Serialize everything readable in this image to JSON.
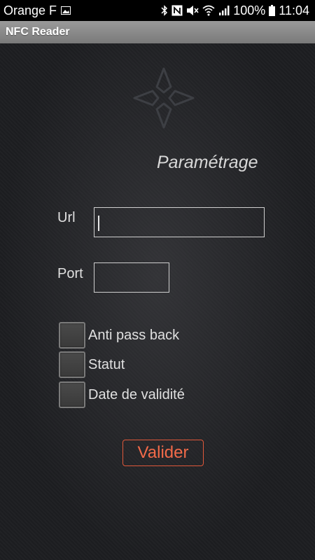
{
  "status_bar": {
    "carrier": "Orange F",
    "battery": "100%",
    "time": "11:04",
    "icons": [
      "image-icon",
      "bluetooth-icon",
      "nfc-icon",
      "mute-icon",
      "wifi-icon",
      "signal-icon",
      "battery-icon"
    ]
  },
  "action_bar": {
    "title": "NFC Reader"
  },
  "form": {
    "title": "Paramétrage",
    "url_label": "Url",
    "url_value": "",
    "port_label": "Port",
    "port_value": "",
    "checkboxes": [
      {
        "label": "Anti pass back",
        "checked": false
      },
      {
        "label": "Statut",
        "checked": false
      },
      {
        "label": "Date de validité",
        "checked": false
      }
    ],
    "validate_label": "Valider"
  },
  "colors": {
    "accent": "#f26a49",
    "background": "#1c1d20",
    "action_bar": "#8a8a8a"
  }
}
